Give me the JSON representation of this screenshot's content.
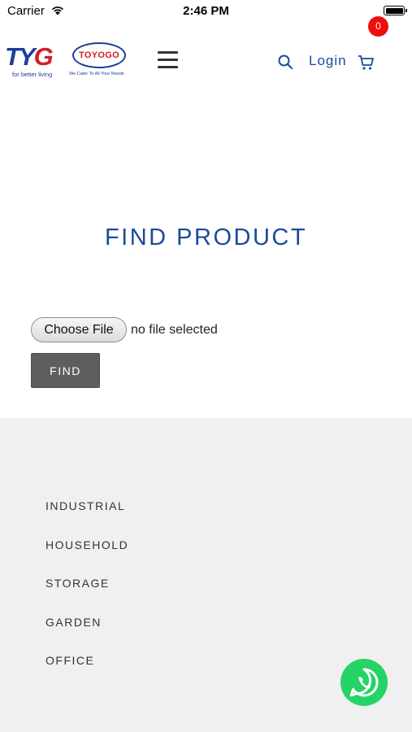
{
  "status_bar": {
    "carrier": "Carrier",
    "time": "2:46 PM"
  },
  "header": {
    "logo_tyg_text": "TY",
    "logo_tyg_g": "G",
    "logo_tyg_tagline": "for better living",
    "logo_toyogo_text": "TOYOGO",
    "logo_toyogo_tagline": "We Cater To All Your Needs",
    "login_label": "Login",
    "cart_count": "0",
    "icons": [
      "hamburger-menu-icon",
      "search-icon",
      "cart-icon"
    ]
  },
  "main": {
    "title": "FIND PRODUCT",
    "choose_file_label": "Choose File",
    "file_status": "no file selected",
    "find_button_label": "FIND"
  },
  "footer": {
    "items": [
      "INDUSTRIAL",
      "HOUSEHOLD",
      "STORAGE",
      "GARDEN",
      "OFFICE"
    ]
  },
  "colors": {
    "brand_blue": "#1b4a9c",
    "brand_red": "#d11f27",
    "badge_red": "#f00d0d",
    "footer_bg": "#f0f0f0",
    "find_button_bg": "#5e5e5e",
    "whatsapp_green": "#25d366"
  }
}
